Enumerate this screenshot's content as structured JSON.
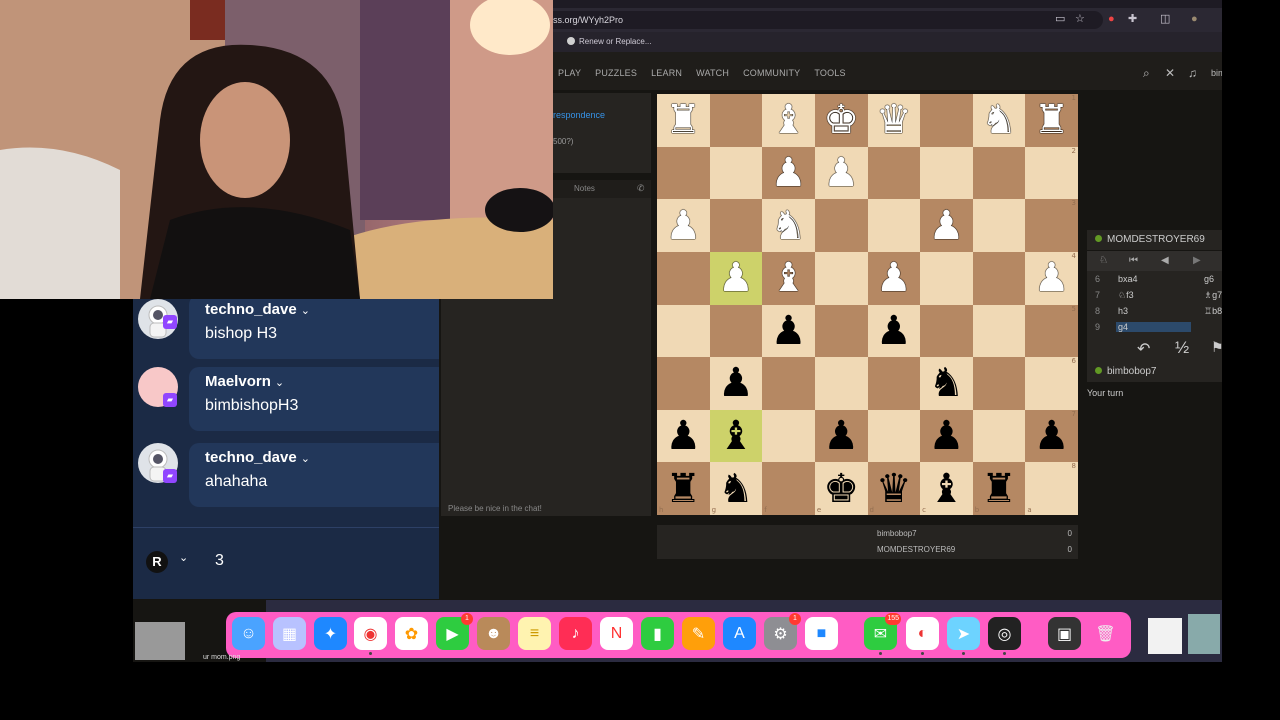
{
  "browser": {
    "url": "ss.org/WYyh2Pro",
    "bookmark": "Renew or Replace..."
  },
  "nav": [
    "PLAY",
    "PUZZLES",
    "LEARN",
    "WATCH",
    "COMMUNITY",
    "TOOLS"
  ],
  "user_short": "bim",
  "left_panel": {
    "link": "respondence",
    "rating": "500?)",
    "notes_tab": "Notes",
    "chat_placeholder": "Please be nice in the chat!"
  },
  "board": {
    "ranks": [
      "1",
      "2",
      "3",
      "4",
      "5",
      "6",
      "7",
      "8"
    ],
    "files": [
      "h",
      "g",
      "f",
      "e",
      "d",
      "c",
      "b",
      "a"
    ],
    "highlight": [
      "g7",
      "g4"
    ],
    "rows": [
      [
        "wR",
        "",
        "wB",
        "wK",
        "wQ",
        "",
        "wN",
        "wR"
      ],
      [
        "",
        "",
        "wP",
        "wP",
        "",
        "",
        "",
        ""
      ],
      [
        "wP",
        "",
        "wN",
        "",
        "",
        "wP",
        "",
        ""
      ],
      [
        "",
        "wP",
        "wB",
        "",
        "wP",
        "",
        "",
        "wP"
      ],
      [
        "",
        "",
        "bP",
        "",
        "bP",
        "",
        "",
        ""
      ],
      [
        "",
        "bP",
        "",
        "",
        "",
        "bN",
        "",
        ""
      ],
      [
        "bP",
        "bB",
        "",
        "bP",
        "",
        "bP",
        "",
        "bP"
      ],
      [
        "bR",
        "bN",
        "",
        "bK",
        "bQ",
        "bB",
        "bR",
        ""
      ]
    ]
  },
  "scores": [
    {
      "name": "bimbobop7",
      "value": "0"
    },
    {
      "name": "MOMDESTROYER69",
      "value": "0"
    }
  ],
  "right_panel": {
    "top_player": "MOMDESTROYER69",
    "bottom_player": "bimbobop7",
    "status": "Your turn",
    "draw_label": "½",
    "moves": [
      {
        "n": "6",
        "w": "bxa4",
        "b": "g6"
      },
      {
        "n": "7",
        "w": "♘f3",
        "b": "♗g7"
      },
      {
        "n": "8",
        "w": "h3",
        "b": "♖b8"
      },
      {
        "n": "9",
        "w": "g4",
        "b": ""
      }
    ]
  },
  "twitch_chat": {
    "messages": [
      {
        "user": "techno_dave",
        "text": "bishop H3"
      },
      {
        "user": "Maelvorn",
        "text": "bimbishopH3"
      },
      {
        "user": "techno_dave",
        "text": "ahahaha"
      }
    ],
    "footer_badge": "R",
    "footer_count": "3"
  },
  "dock": {
    "desktop_label": "ur mom.png",
    "badges": {
      "facetime": "1",
      "settings": "1",
      "messages": "155"
    }
  }
}
